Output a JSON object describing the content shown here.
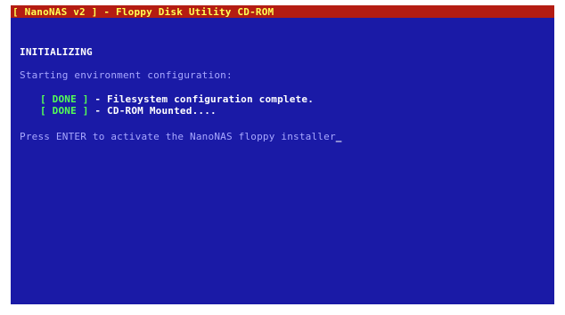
{
  "title": "[ NanoNAS v2 ] - Floppy Disk Utility CD-ROM",
  "heading": "INITIALIZING",
  "status_title": "Starting environment configuration:",
  "status_rows": [
    {
      "badge": "[ DONE ]",
      "text": " - Filesystem configuration complete."
    },
    {
      "badge": "[ DONE ]",
      "text": " - CD-ROM Mounted...."
    }
  ],
  "prompt": "Press ENTER to activate the NanoNAS floppy installer",
  "cursor": "_"
}
